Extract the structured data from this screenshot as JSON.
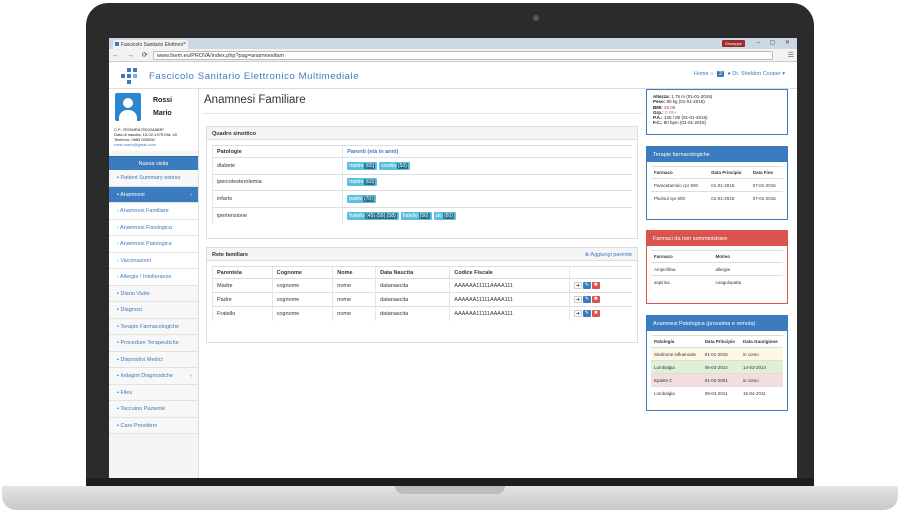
{
  "browser": {
    "tab_title": "Fascicolo Sanitario Elettroni",
    "tab_close": "×",
    "profile": "Giuseppe",
    "window_controls": "‒ ▢ ✕",
    "nav": "← → ⟳",
    "home": "⌂",
    "url": "www.fsem.eu/PROVA/index.php?pag=anamnesifam",
    "menu": "☰"
  },
  "app": {
    "title": "Fascicolo Sanitario Elettronico Multimediale",
    "header": {
      "home": "Home",
      "home_icon": "⌂",
      "count": "2",
      "user": "Dr. Sheldon Cooper",
      "chevron": "▾"
    }
  },
  "patient": {
    "surname": "Rossi",
    "name": "Mario",
    "cf": "C.F.: RSSMRA75S02A883F",
    "birth": "Data di nascita: 15-02-1975 Età: 40",
    "phone": "Telefono: 0883 000000",
    "email": "rossi.mario@gmail.com"
  },
  "sidebar": {
    "visit_button": "Nuova visita",
    "items": [
      {
        "label": "Patient Summary esteso",
        "icon": "list"
      },
      {
        "label": "Anamnesi",
        "icon": "list",
        "active": true,
        "chev": "‹"
      },
      {
        "label": "› Anamnesi Familiare"
      },
      {
        "label": "› Anamnesi Fisiologica"
      },
      {
        "label": "› Anamnesi Patologica"
      },
      {
        "label": "› Vaccinazioni"
      },
      {
        "label": "› Allergie / Intolleranze"
      },
      {
        "label": "Diario Visite"
      },
      {
        "label": "Diagnosi"
      },
      {
        "label": "Terapie Farmacologiche"
      },
      {
        "label": "Procedure Terapeutiche"
      },
      {
        "label": "Dispositivi Medici"
      },
      {
        "label": "Indagini Diagnostiche",
        "chev": "‹"
      },
      {
        "label": "Files"
      },
      {
        "label": "Taccuino Paziente"
      },
      {
        "label": "Care Providers"
      }
    ]
  },
  "main": {
    "title": "Anamnesi Familiare",
    "quadro": {
      "heading": "Quadro sinottico",
      "col_patologie": "Patologie",
      "col_parenti": "Parenti (età in anni)",
      "rows": [
        {
          "patologia": "diabete",
          "parenti": [
            {
              "n": "madre",
              "age": "(65)"
            },
            {
              "n": "sorella",
              "age": "(50)"
            }
          ]
        },
        {
          "patologia": "ipercolesterolemia",
          "parenti": [
            {
              "n": "madre",
              "age": "(60)"
            }
          ]
        },
        {
          "patologia": "infarto",
          "parenti": [
            {
              "n": "padre",
              "age": "(70)"
            }
          ]
        },
        {
          "patologia": "ipertensione",
          "parenti": [
            {
              "n": "fratello",
              "age": "(45) (56) (58)"
            },
            {
              "n": "fratello",
              "age": "(56)"
            },
            {
              "n": "zio",
              "age": "(60)"
            }
          ]
        }
      ]
    },
    "rete": {
      "heading": "Rete familiare",
      "add": "Aggiungi parente",
      "add_icon": "⊕",
      "cols": [
        "Parentela",
        "Cognome",
        "Nome",
        "Data Nascita",
        "Codice Fiscale",
        ""
      ],
      "rows": [
        [
          "Madre",
          "cognome",
          "nome",
          "datanascita",
          "AAAAAA11111AAAA111"
        ],
        [
          "Padre",
          "cognome",
          "nome",
          "datanascita",
          "AAAAAA11111AAAA111"
        ],
        [
          "Fratello",
          "cognome",
          "nome",
          "datanascita",
          "AAAAAA11111AAAA111"
        ]
      ]
    }
  },
  "right": {
    "vitals": [
      {
        "k": "Altezza:",
        "v": "1.75 m (01-01-2015)"
      },
      {
        "k": "Peso:",
        "v": "80 kg (01-01-2015)"
      },
      {
        "k": "BMI:",
        "v": "26.08",
        "c": "v"
      },
      {
        "k": "Grp.:",
        "v": "0 Rh+",
        "c": "g"
      },
      {
        "k": "P.A.:",
        "v": "120 / 80 (01-01-2015)"
      },
      {
        "k": "F.C.:",
        "v": "80 bpm (01-01-2015)"
      }
    ],
    "terapie": {
      "title": "Terapie farmacologiche",
      "cols": [
        "Farmaco",
        "Data Principio",
        "Data Fine"
      ],
      "rows": [
        [
          "Paracetamolo cpr 500",
          "01-01-2015",
          "07-01-2015"
        ],
        [
          "Plurisul cpr 600",
          "01-01-2015",
          "07-01-2015"
        ]
      ]
    },
    "nonsomm": {
      "title": "Farmaci da non somministrare",
      "cols": [
        "Farmaco",
        "Motivo"
      ],
      "rows": [
        [
          "Ampicillina",
          "allergia"
        ],
        [
          "aspirina",
          "coagulopatia"
        ]
      ]
    },
    "patologica": {
      "title": "Anamnesi Patologica (prossima e remota)",
      "cols": [
        "Patologia",
        "Data Principio",
        "Data Guarigione"
      ],
      "rows": [
        [
          "Sindrome influenzale",
          "01-01-2015",
          "in corso"
        ],
        [
          "Lombalgia",
          "06-03-2014",
          "14-03-2014"
        ],
        [
          "Epatite C",
          "01-03-2001",
          "in corso"
        ],
        [
          "Lombalgia",
          "08-04-2011",
          "15-04-2011"
        ]
      ]
    }
  },
  "colors": {
    "accent": "#3b7bbf",
    "danger": "#d9534f",
    "label": "#5bc0de"
  }
}
